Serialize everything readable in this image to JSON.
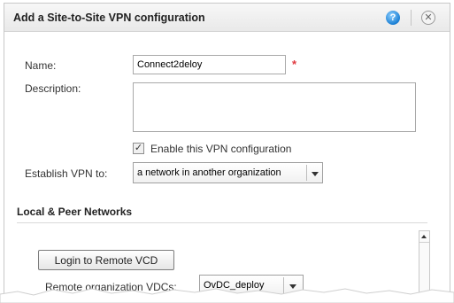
{
  "dialog": {
    "title": "Add a Site-to-Site VPN configuration",
    "help_icon": "question-circle-icon",
    "close_icon": "close-circle-icon"
  },
  "form": {
    "name_label": "Name:",
    "name_value": "Connect2deloy",
    "required_marker": "*",
    "description_label": "Description:",
    "description_value": "",
    "enable_label": "Enable this VPN configuration",
    "enable_checked": true,
    "establish_label": "Establish VPN to:",
    "establish_value": "a network in another organization"
  },
  "section": {
    "title": "Local & Peer Networks",
    "login_button": "Login to Remote VCD",
    "remote_org_label": "Remote organization VDCs:",
    "remote_org_value": "OvDC_deploy"
  },
  "colors": {
    "required": "#e0383e",
    "help_icon": "#1a7fd4"
  }
}
